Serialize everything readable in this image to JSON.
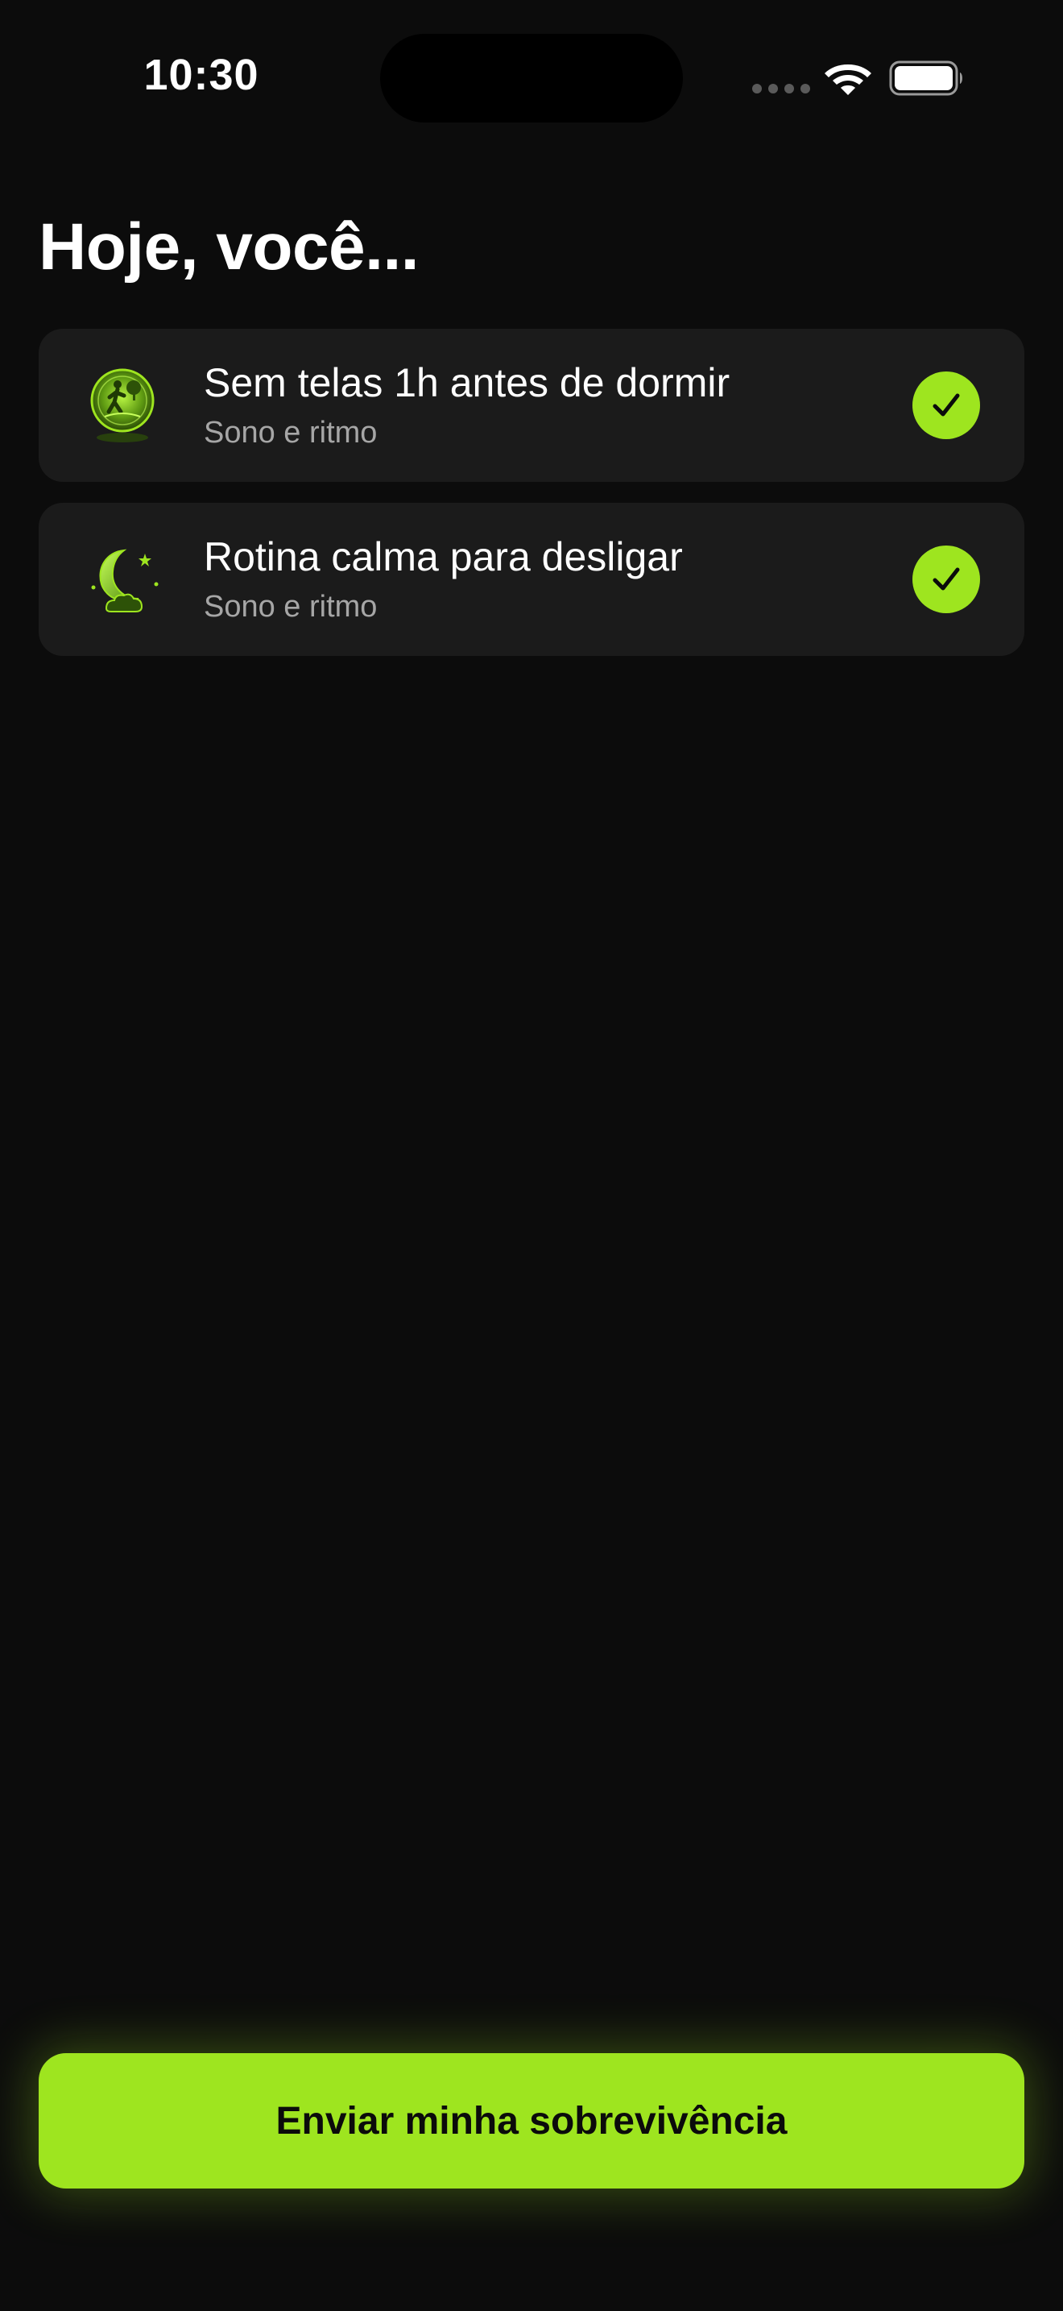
{
  "status_bar": {
    "time": "10:30",
    "icons": [
      "signal-dots-icon",
      "wifi-icon",
      "battery-icon"
    ]
  },
  "header": {
    "title": "Hoje, você..."
  },
  "habits": [
    {
      "title": "Sem telas 1h antes de dormir",
      "category": "Sono e ritmo",
      "icon": "walking-person-icon",
      "checked": true
    },
    {
      "title": "Rotina calma para desligar",
      "category": "Sono e ritmo",
      "icon": "moon-cloud-icon",
      "checked": true
    }
  ],
  "submit": {
    "label": "Enviar minha sobrevivência"
  },
  "colors": {
    "background": "#0c0c0c",
    "card": "#1b1b1b",
    "accent": "#9ee51f",
    "subtitle": "#a6a6a6"
  }
}
